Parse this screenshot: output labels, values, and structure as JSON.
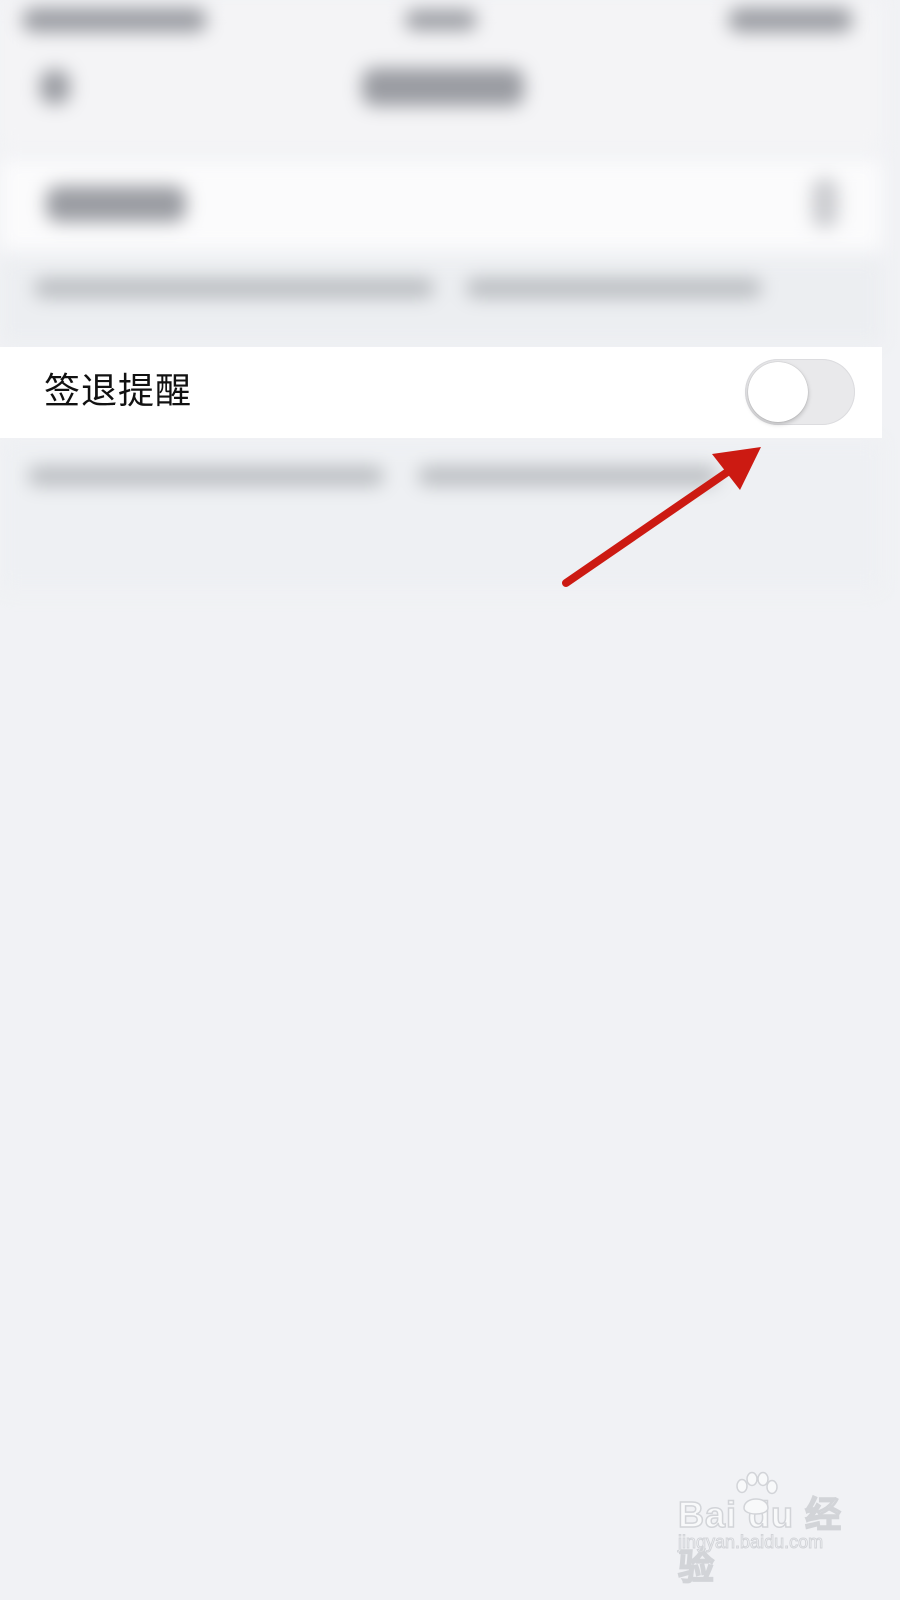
{
  "setting": {
    "label": "签退提醒",
    "toggle_state": "off"
  },
  "annotation": {
    "color": "#cc1a12"
  },
  "watermark": {
    "brand": "Bai du 经验",
    "url": "jingyan.baidu.com"
  },
  "colors": {
    "background": "#f1f2f5",
    "row_background": "#ffffff",
    "toggle_off_track": "#e9e9eb"
  }
}
